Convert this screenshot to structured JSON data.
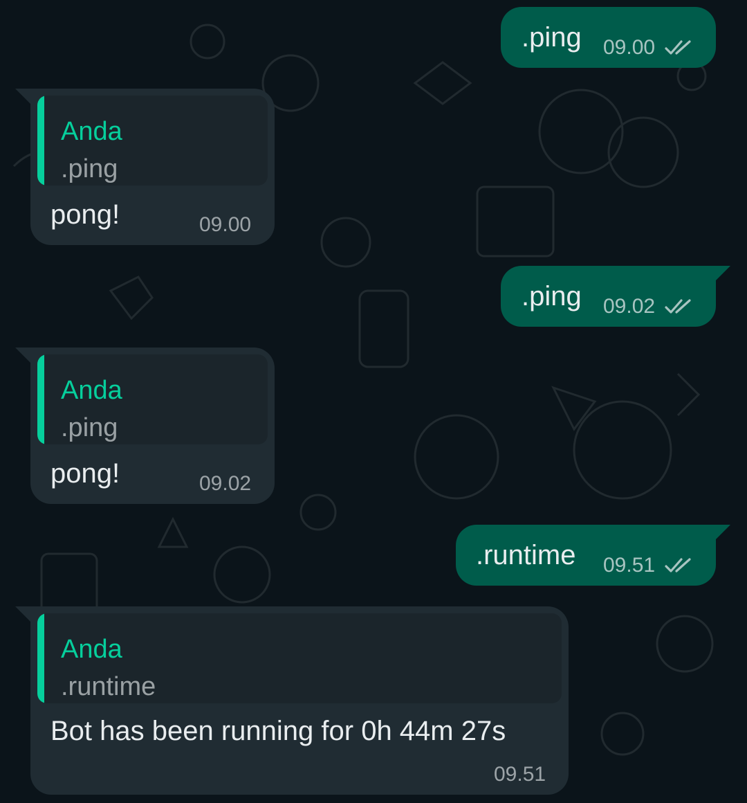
{
  "messages": [
    {
      "direction": "outgoing",
      "text": ".ping",
      "time": "09.00",
      "status_icon": "double-check-icon",
      "read": false
    },
    {
      "direction": "incoming",
      "quoted_author": "Anda",
      "quoted_text": ".ping",
      "text": "pong!",
      "time": "09.00"
    },
    {
      "direction": "outgoing",
      "text": ".ping",
      "time": "09.02",
      "status_icon": "double-check-icon",
      "read": false
    },
    {
      "direction": "incoming",
      "quoted_author": "Anda",
      "quoted_text": ".ping",
      "text": "pong!",
      "time": "09.02"
    },
    {
      "direction": "outgoing",
      "text": ".runtime",
      "time": "09.51",
      "status_icon": "double-check-icon",
      "read": false
    },
    {
      "direction": "incoming",
      "quoted_author": "Anda",
      "quoted_text": ".runtime",
      "text": "Bot has been running for 0h 44m 27s",
      "time": "09.51"
    }
  ],
  "colors": {
    "background": "#0b141a",
    "outgoing_bubble": "#005c4b",
    "incoming_bubble": "#202c33",
    "quote_bar": "#06cf9c",
    "text": "#e9edef"
  }
}
